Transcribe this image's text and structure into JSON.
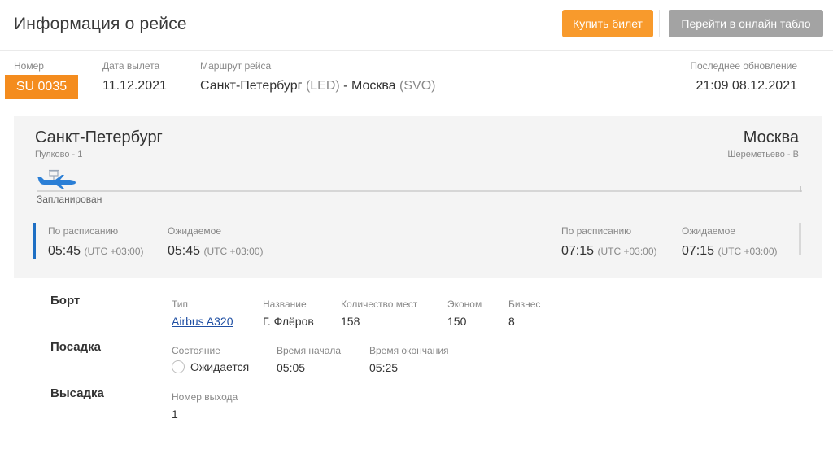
{
  "header": {
    "title": "Информация о рейсе",
    "buy_button": "Купить билет",
    "board_button": "Перейти в онлайн табло"
  },
  "summary": {
    "number_label": "Номер",
    "number_value": "SU 0035",
    "date_label": "Дата вылета",
    "date_value": "11.12.2021",
    "route_label": "Маршрут рейса",
    "route_from": "Санкт-Петербург",
    "route_from_code": "(LED)",
    "route_sep": " - ",
    "route_to": "Москва",
    "route_to_code": "(SVO)",
    "updated_label": "Последнее обновление",
    "updated_value": "21:09 08.12.2021"
  },
  "route": {
    "from_city": "Санкт-Петербург",
    "from_airport": "Пулково - 1",
    "to_city": "Москва",
    "to_airport": "Шереметьево - B",
    "status": "Запланирован",
    "progress": 0
  },
  "times": {
    "departure": {
      "scheduled_label": "По расписанию",
      "scheduled_time": "05:45",
      "scheduled_tz": "(UTC +03:00)",
      "expected_label": "Ожидаемое",
      "expected_time": "05:45",
      "expected_tz": "(UTC +03:00)"
    },
    "arrival": {
      "scheduled_label": "По расписанию",
      "scheduled_time": "07:15",
      "scheduled_tz": "(UTC +03:00)",
      "expected_label": "Ожидаемое",
      "expected_time": "07:15",
      "expected_tz": "(UTC +03:00)"
    }
  },
  "details": {
    "aircraft": {
      "title": "Борт",
      "type_label": "Тип",
      "type_value": "Airbus A320",
      "name_label": "Название",
      "name_value": "Г. Флёров",
      "seats_label": "Количество мест",
      "seats_value": "158",
      "economy_label": "Эконом",
      "economy_value": "150",
      "business_label": "Бизнес",
      "business_value": "8"
    },
    "boarding": {
      "title": "Посадка",
      "state_label": "Состояние",
      "state_value": "Ожидается",
      "start_label": "Время начала",
      "start_value": "05:05",
      "end_label": "Время окончания",
      "end_value": "05:25"
    },
    "deboarding": {
      "title": "Высадка",
      "gate_label": "Номер выхода",
      "gate_value": "1"
    }
  },
  "icons": {
    "plane": "airplane-icon",
    "radio": "radio-icon"
  },
  "colors": {
    "accent": "#f48c1e",
    "buy": "#f89a2c",
    "disabled": "#a3a3a3",
    "link": "#1f4fa3",
    "plane": "#2b7fd6"
  }
}
